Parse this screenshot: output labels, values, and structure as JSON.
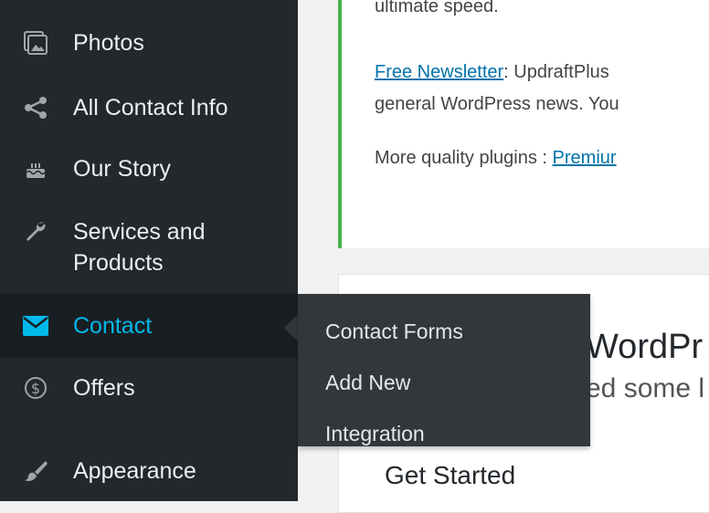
{
  "sidebar": {
    "items": [
      {
        "label": "Photos",
        "icon": "photos-icon"
      },
      {
        "label": "All Contact Info",
        "icon": "share-icon"
      },
      {
        "label": "Our Story",
        "icon": "cake-icon"
      },
      {
        "label": "Services and Products",
        "icon": "wrench-icon"
      },
      {
        "label": "Contact",
        "icon": "mail-icon"
      },
      {
        "label": "Offers",
        "icon": "dollar-icon"
      },
      {
        "label": "Appearance",
        "icon": "brush-icon"
      }
    ]
  },
  "submenu": {
    "items": [
      "Contact Forms",
      "Add New",
      "Integration"
    ]
  },
  "notice": {
    "line1": "ultimate speed.",
    "newsletter_link": "Free Newsletter",
    "newsletter_text": ": UpdraftPlus",
    "line3": "general WordPress news. You",
    "quality_label": "More quality plugins : ",
    "premium_link": "Premiur"
  },
  "welcome": {
    "title_fragment": "WordPr",
    "sub_fragment": "ed some l",
    "get_started": "Get Started"
  },
  "colors": {
    "sidebar_bg": "#23282d",
    "current_bg": "#191e23",
    "accent": "#00b9eb",
    "submenu_bg": "#32373c",
    "notice_border": "#46b450",
    "link": "#0073aa"
  }
}
